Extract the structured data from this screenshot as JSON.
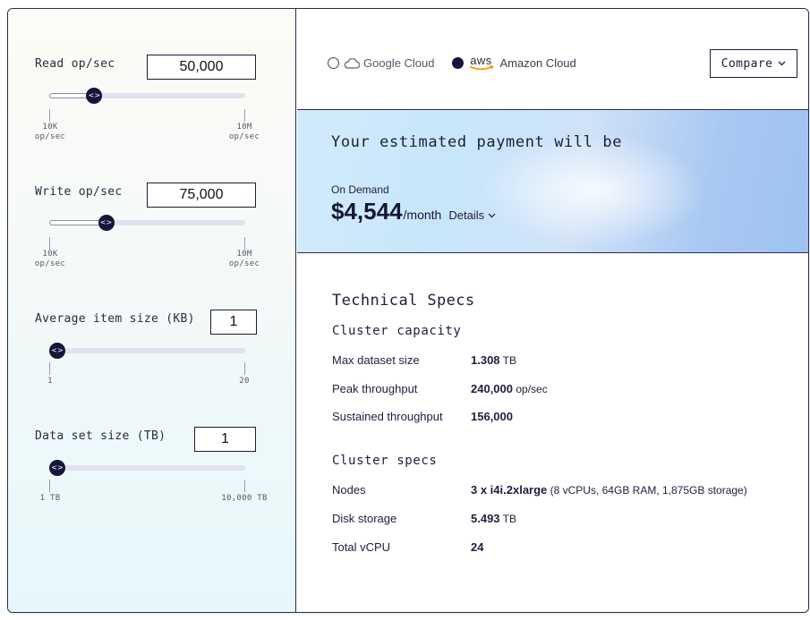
{
  "sliders": [
    {
      "label": "Read op/sec",
      "value": "50,000",
      "min_label": [
        "10K",
        "op/sec"
      ],
      "max_label": [
        "10M",
        "op/sec"
      ],
      "position": 0.23
    },
    {
      "label": "Write op/sec",
      "value": "75,000",
      "min_label": [
        "10K",
        "op/sec"
      ],
      "max_label": [
        "10M",
        "op/sec"
      ],
      "position": 0.29
    },
    {
      "label": "Average item size (KB)",
      "value": "1",
      "min_label": [
        "1"
      ],
      "max_label": [
        "20"
      ],
      "position": 0.0
    },
    {
      "label": "Data set size (TB)",
      "value": "1",
      "min_label": [
        "1 TB"
      ],
      "max_label": [
        "10,000 TB"
      ],
      "position": 0.0
    }
  ],
  "providers": {
    "google": {
      "label": "Google Cloud",
      "selected": false
    },
    "amazon": {
      "logo_text": "aws",
      "label": "Amazon Cloud",
      "selected": true
    }
  },
  "compare_button": {
    "label": "Compare"
  },
  "estimate": {
    "title": "Your estimated payment will be",
    "plan": "On Demand",
    "amount": "$4,544",
    "period": "/month",
    "details_label": "Details"
  },
  "specs": {
    "title": "Technical Specs",
    "capacity": {
      "title": "Cluster capacity",
      "rows": [
        {
          "label": "Max dataset size",
          "value": "1.308",
          "unit": "TB"
        },
        {
          "label": "Peak throughput",
          "value": "240,000",
          "unit": "op/sec"
        },
        {
          "label": "Sustained throughput",
          "value": "156,000",
          "unit": ""
        }
      ]
    },
    "cluster": {
      "title": "Cluster specs",
      "rows": [
        {
          "label": "Nodes",
          "value": "3 x i4i.2xlarge",
          "unit": "(8 vCPUs, 64GB RAM, 1,875GB storage)"
        },
        {
          "label": "Disk storage",
          "value": "5.493",
          "unit": "TB"
        },
        {
          "label": "Total vCPU",
          "value": "24",
          "unit": ""
        }
      ]
    }
  },
  "colors": {
    "accent": "#14163a",
    "border": "#2a2c4a"
  }
}
